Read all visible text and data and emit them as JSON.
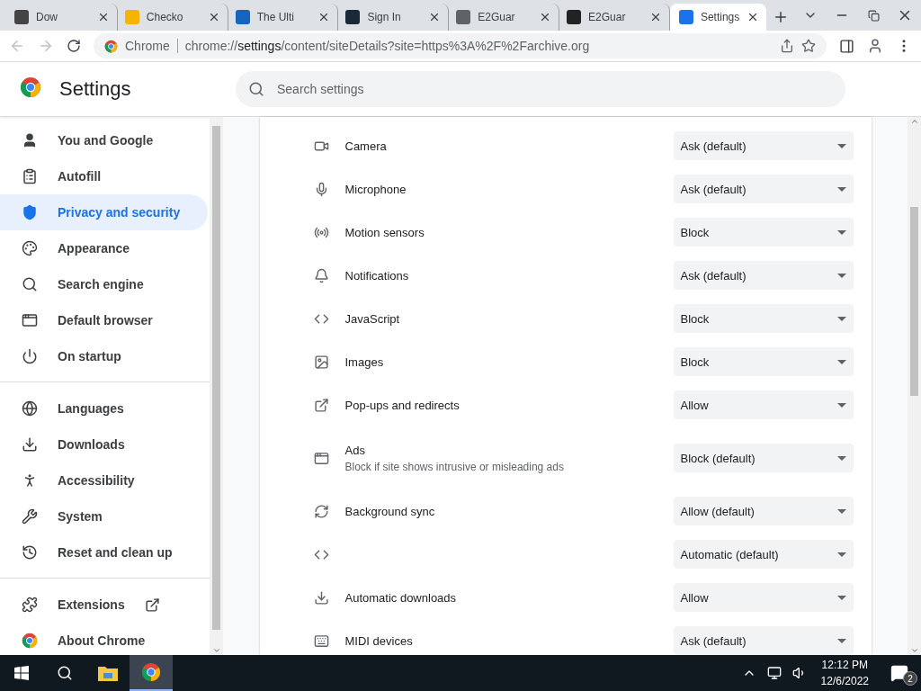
{
  "tabs": [
    {
      "title": "Dow",
      "selected": false
    },
    {
      "title": "Checko",
      "selected": false
    },
    {
      "title": "The Ulti",
      "selected": false
    },
    {
      "title": "Sign In",
      "selected": false
    },
    {
      "title": "E2Guar",
      "selected": false
    },
    {
      "title": "E2Guar",
      "selected": false
    },
    {
      "title": "Settings",
      "selected": true
    }
  ],
  "address": {
    "site_label": "Chrome",
    "url_scheme": "chrome://",
    "url_host": "settings",
    "url_path": "/content/siteDetails?site=https%3A%2F%2Farchive.org"
  },
  "header": {
    "title": "Settings",
    "search_placeholder": "Search settings"
  },
  "sidebar": {
    "groups": [
      [
        {
          "label": "You and Google",
          "selected": false
        },
        {
          "label": "Autofill",
          "selected": false
        },
        {
          "label": "Privacy and security",
          "selected": true
        },
        {
          "label": "Appearance",
          "selected": false
        },
        {
          "label": "Search engine",
          "selected": false
        },
        {
          "label": "Default browser",
          "selected": false
        },
        {
          "label": "On startup",
          "selected": false
        }
      ],
      [
        {
          "label": "Languages",
          "selected": false
        },
        {
          "label": "Downloads",
          "selected": false
        },
        {
          "label": "Accessibility",
          "selected": false
        },
        {
          "label": "System",
          "selected": false
        },
        {
          "label": "Reset and clean up",
          "selected": false
        }
      ],
      [
        {
          "label": "Extensions",
          "selected": false
        },
        {
          "label": "About Chrome",
          "selected": false
        }
      ]
    ]
  },
  "permissions": [
    {
      "label": "Camera",
      "value": "Ask (default)"
    },
    {
      "label": "Microphone",
      "value": "Ask (default)"
    },
    {
      "label": "Motion sensors",
      "value": "Block"
    },
    {
      "label": "Notifications",
      "value": "Ask (default)"
    },
    {
      "label": "JavaScript",
      "value": "Block"
    },
    {
      "label": "Images",
      "value": "Block"
    },
    {
      "label": "Pop-ups and redirects",
      "value": "Allow"
    },
    {
      "label": "Ads",
      "sublabel": "Block if site shows intrusive or misleading ads",
      "value": "Block (default)"
    },
    {
      "label": "Background sync",
      "value": "Allow (default)"
    },
    {
      "value": "Automatic (default)"
    },
    {
      "label": "Automatic downloads",
      "value": "Allow"
    },
    {
      "label": "MIDI devices",
      "value": "Ask (default)"
    }
  ],
  "taskbar": {
    "time": "12:12 PM",
    "date": "12/6/2022",
    "notification_count": "2"
  }
}
